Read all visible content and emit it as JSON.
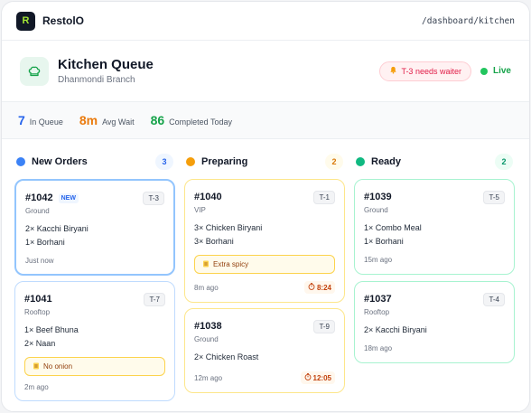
{
  "topbar": {
    "logo_letter": "R",
    "brand": "RestolO",
    "path": "/dashboard/kitchen"
  },
  "header": {
    "title": "Kitchen Queue",
    "subtitle": "Dhanmondi Branch",
    "alert": "T-3 needs waiter",
    "live_label": "Live"
  },
  "stats": [
    {
      "value": "7",
      "label": "In Queue",
      "color": "#2563eb"
    },
    {
      "value": "8m",
      "label": "Avg Wait",
      "color": "#ea7a0c"
    },
    {
      "value": "86",
      "label": "Completed Today",
      "color": "#16a34a"
    }
  ],
  "columns": [
    {
      "title": "New Orders",
      "count": "3",
      "accent": "#3b82f6",
      "orders": [
        {
          "id": "#1042",
          "badge": "NEW",
          "table": "T-3",
          "area": "Ground",
          "items": [
            "2× Kacchi Biryani",
            "1× Borhani"
          ],
          "note": "",
          "time": "Just now",
          "timer": ""
        },
        {
          "id": "#1041",
          "badge": "",
          "table": "T-7",
          "area": "Rooftop",
          "items": [
            "1× Beef Bhuna",
            "2× Naan"
          ],
          "note": "No onion",
          "time": "2m ago",
          "timer": ""
        }
      ]
    },
    {
      "title": "Preparing",
      "count": "2",
      "accent": "#f59e0b",
      "orders": [
        {
          "id": "#1040",
          "badge": "",
          "table": "T-1",
          "area": "VIP",
          "items": [
            "3× Chicken Biryani",
            "3× Borhani"
          ],
          "note": "Extra spicy",
          "time": "8m ago",
          "timer": "8:24"
        },
        {
          "id": "#1038",
          "badge": "",
          "table": "T-9",
          "area": "Ground",
          "items": [
            "2× Chicken Roast"
          ],
          "note": "",
          "time": "12m ago",
          "timer": "12:05"
        }
      ]
    },
    {
      "title": "Ready",
      "count": "2",
      "accent": "#10b981",
      "orders": [
        {
          "id": "#1039",
          "badge": "",
          "table": "T-5",
          "area": "Ground",
          "items": [
            "1× Combo Meal",
            "1× Borhani"
          ],
          "note": "",
          "time": "15m ago",
          "timer": ""
        },
        {
          "id": "#1037",
          "badge": "",
          "table": "T-4",
          "area": "Rooftop",
          "items": [
            "2× Kacchi Biryani"
          ],
          "note": "",
          "time": "18m ago",
          "timer": ""
        }
      ]
    }
  ]
}
